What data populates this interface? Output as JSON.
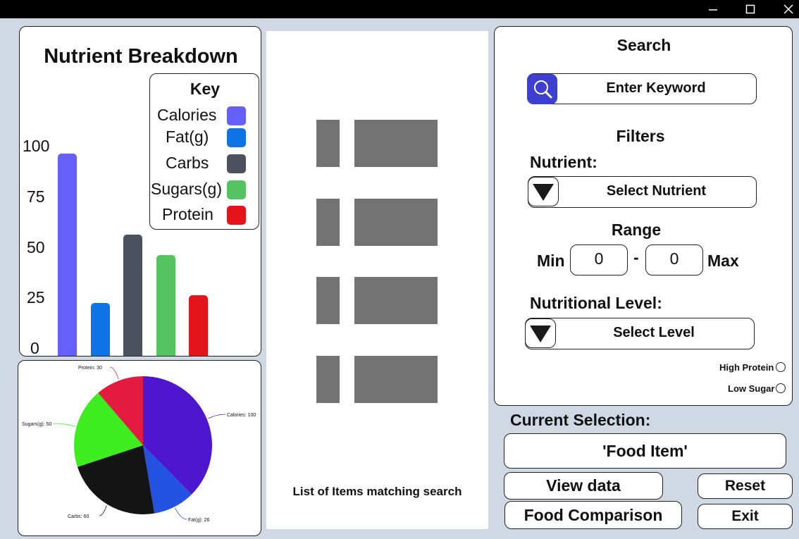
{
  "window": {
    "minimize_symbol": "—",
    "close_symbol": "✕"
  },
  "chart_data": [
    {
      "type": "bar",
      "title": "Nutrient Breakdown",
      "legend_title": "Key",
      "legend_position": "top-right",
      "categories": [
        "Calories",
        "Fat(g)",
        "Carbs",
        "Sugars(g)",
        "Protein"
      ],
      "values": [
        100,
        26,
        60,
        50,
        30
      ],
      "colors": [
        "#6660fb",
        "#0f74e6",
        "#4b525e",
        "#56c363",
        "#e3151a"
      ],
      "yticks": [
        "0",
        "25",
        "50",
        "75",
        "100"
      ],
      "ylim": [
        0,
        100
      ],
      "grid": false
    },
    {
      "type": "pie",
      "slices": [
        {
          "label": "Calories: 100",
          "value": 100,
          "color": "#4f16cf"
        },
        {
          "label": "Fat(g): 26",
          "value": 26,
          "color": "#2353e0"
        },
        {
          "label": "Carbs: 60",
          "value": 60,
          "color": "#141414"
        },
        {
          "label": "Sugars(g): 50",
          "value": 50,
          "color": "#3ded20"
        },
        {
          "label": "Protein: 30",
          "value": 30,
          "color": "#e31b40"
        }
      ]
    }
  ],
  "list": {
    "caption": "List of Items matching search",
    "placeholder_rows": 4
  },
  "search": {
    "title": "Search",
    "keyword_placeholder": "Enter Keyword",
    "filters_title": "Filters",
    "nutrient_label": "Nutrient:",
    "nutrient_select": "Select Nutrient",
    "range_label": "Range",
    "min_label": "Min",
    "min_value": "0",
    "range_separator": "-",
    "max_value": "0",
    "max_label": "Max",
    "level_label": "Nutritional Level:",
    "level_select": "Select Level",
    "high_protein": "High Protein",
    "low_sugar": "Low Sugar",
    "accent_color": "#3d3fd1"
  },
  "selection": {
    "label": "Current Selection:",
    "value": "'Food Item'"
  },
  "buttons": {
    "view_data": "View data",
    "reset": "Reset",
    "food_comparison": "Food Comparison",
    "exit": "Exit"
  }
}
